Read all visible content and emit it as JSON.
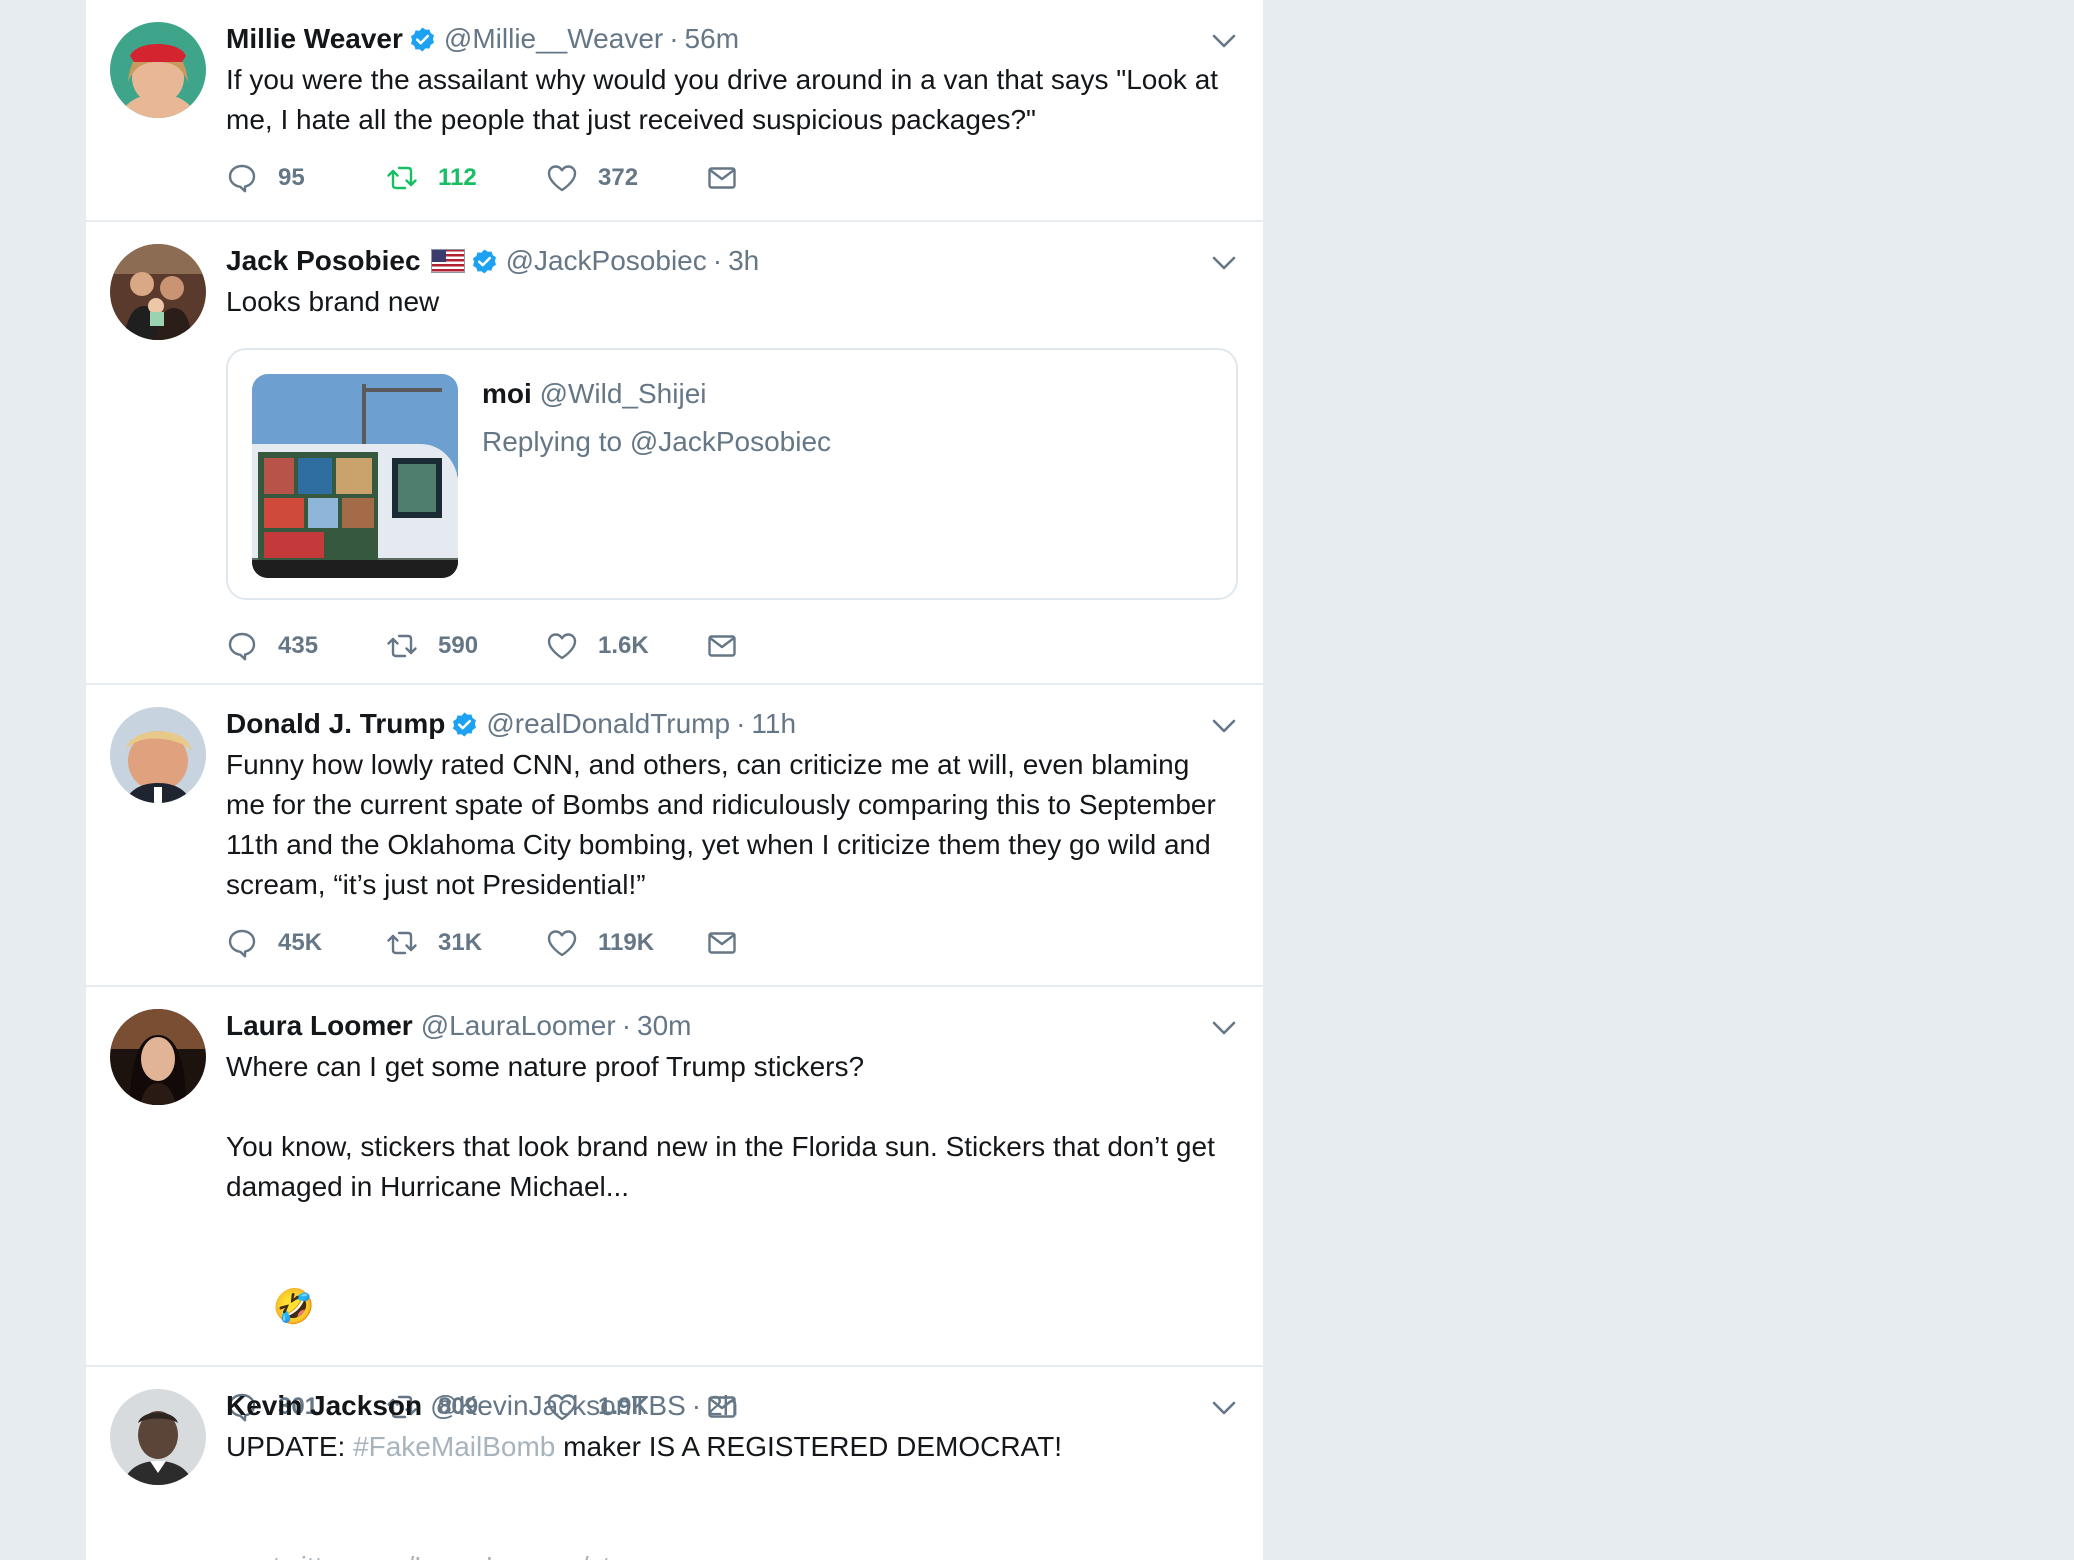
{
  "tweets": [
    {
      "name": "Millie Weaver",
      "handle": "@Millie__Weaver",
      "separator": "·",
      "time": "56m",
      "text": "If you were the assailant why would you drive around in a van that says \"Look at me, I hate all the people that just received suspicious packages?\"",
      "replies": "95",
      "retweets": "112",
      "likes": "372"
    },
    {
      "name": "Jack Posobiec",
      "handle": "@JackPosobiec",
      "separator": "·",
      "time": "3h",
      "text": "Looks brand new",
      "quote": {
        "name": "moi",
        "handle": "@Wild_Shijei",
        "reply": "Replying to @JackPosobiec"
      },
      "replies": "435",
      "retweets": "590",
      "likes": "1.6K"
    },
    {
      "name": "Donald J. Trump",
      "handle": "@realDonaldTrump",
      "separator": "·",
      "time": "11h",
      "text": "Funny how lowly rated CNN, and others, can criticize me at will, even blaming me for the current spate of Bombs and ridiculously comparing this to September 11th and the Oklahoma City bombing, yet when I criticize them they go wild and scream, “it’s just not Presidential!”",
      "replies": "45K",
      "retweets": "31K",
      "likes": "119K"
    },
    {
      "name": "Laura Loomer",
      "handle": "@LauraLoomer",
      "separator": "·",
      "time": "30m",
      "text": "Where can I get some nature proof Trump stickers?\n\nYou know, stickers that look brand new in the Florida sun. Stickers that don’t get damaged in Hurricane Michael...",
      "emoji": "🤣",
      "replies": "301",
      "retweets": "809",
      "likes": "1.9K"
    },
    {
      "name": "Kevin Jackson",
      "handle": "@KevinJacksonTBS",
      "separator": "·",
      "time": "2h",
      "text_before": "UPDATE: ",
      "hashtag": "#FakeMailBomb",
      "text_after": " maker IS A REGISTERED DEMOCRAT!",
      "link": "twitter.com/LauraLoomer/st…"
    }
  ],
  "colors": {
    "background": "#e6ecf0",
    "verified": "#1da1f2",
    "retweet_active": "#17bf63",
    "muted": "#657786"
  },
  "icons": [
    "reply-icon",
    "retweet-icon",
    "like-icon",
    "message-icon",
    "verified-icon",
    "chevron-down-icon",
    "us-flag-icon"
  ]
}
